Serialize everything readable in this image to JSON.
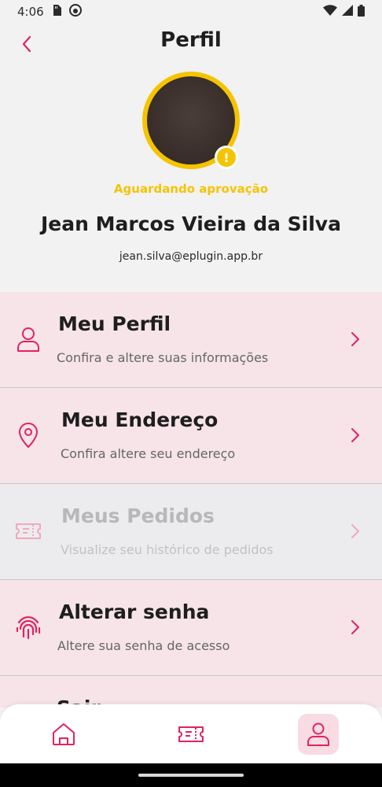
{
  "status_bar": {
    "time": "4:06"
  },
  "header": {
    "title": "Perfil"
  },
  "profile": {
    "status": "Aguardando aprovação",
    "name": "Jean Marcos Vieira da Silva",
    "email": "jean.silva@eplugin.app.br"
  },
  "menu": {
    "items": [
      {
        "title": "Meu Perfil",
        "subtitle": "Confira e altere suas informações",
        "icon": "user-icon"
      },
      {
        "title": "Meu Endereço",
        "subtitle": "Confira altere seu endereço",
        "icon": "location-pin-icon"
      },
      {
        "title": "Meus Pedidos",
        "subtitle": "Visualize seu histórico de pedidos",
        "icon": "ticket-icon",
        "disabled": true
      },
      {
        "title": "Alterar senha",
        "subtitle": "Altere sua senha de acesso",
        "icon": "fingerprint-icon"
      },
      {
        "title": "Sair",
        "icon": "logout-icon"
      }
    ]
  },
  "bottom_nav": {
    "items": [
      {
        "icon": "home-icon"
      },
      {
        "icon": "ticket-icon"
      },
      {
        "icon": "user-icon",
        "active": true
      }
    ]
  },
  "colors": {
    "accent": "#e0245e",
    "warning": "#f5c400",
    "menu_bg": "#f6e4e9",
    "disabled_bg": "#ececee"
  }
}
